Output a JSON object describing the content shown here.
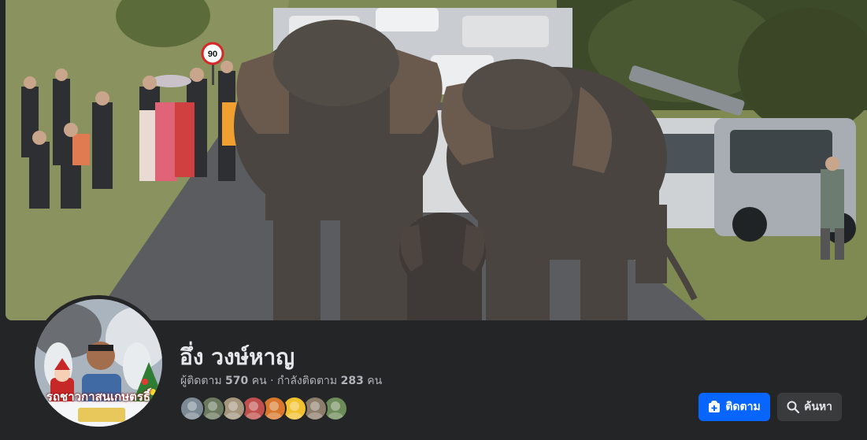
{
  "profile": {
    "name": "อึ่ง วงษ์หาญ",
    "followers_label": "ผู้ติดตาม",
    "followers_count": "570",
    "followers_unit": "คน",
    "separator": " · ",
    "following_label": "กำลังติดตาม",
    "following_count": "283",
    "following_unit": "คน"
  },
  "avatar": {
    "caption": "รถชาวกาสนเกษตรธิ์",
    "icon": "profile-photo"
  },
  "actions": {
    "follow_label": "ติดตาม",
    "follow_icon": "add-friend-icon",
    "search_label": "ค้นหา",
    "search_icon": "search-icon"
  },
  "cover": {
    "road_sign": "90",
    "description_icon": "cover-photo"
  },
  "follower_avatars": [
    {
      "color": "#7c8a96"
    },
    {
      "color": "#6b7a5e"
    },
    {
      "color": "#a5967d"
    },
    {
      "color": "#c0504d"
    },
    {
      "color": "#d9782d"
    },
    {
      "color": "#f2c12e"
    },
    {
      "color": "#8c7e6a"
    },
    {
      "color": "#6e8c5a"
    }
  ],
  "colors": {
    "background": "#242526",
    "primary": "#0866ff",
    "secondary_button": "#3a3b3c",
    "text_primary": "#e4e6eb",
    "text_secondary": "#b0b3b8"
  }
}
